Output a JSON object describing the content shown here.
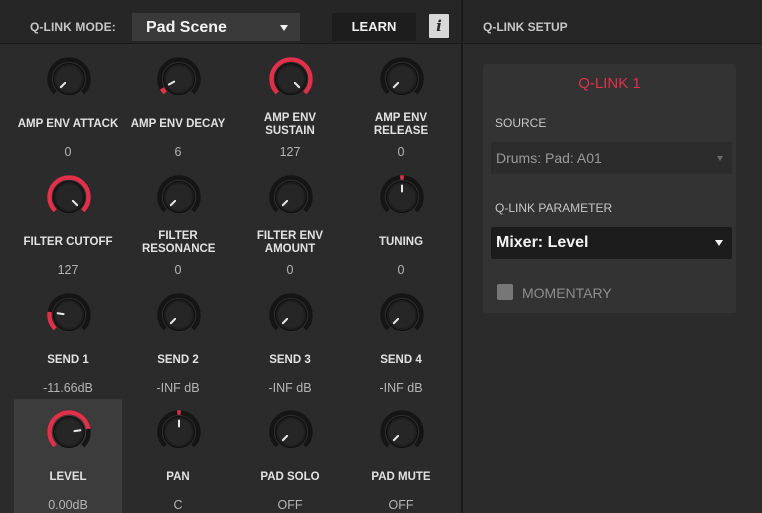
{
  "header": {
    "mode_label": "Q-LINK MODE:",
    "mode_value": "Pad Scene",
    "learn_label": "LEARN",
    "info_label": "i",
    "setup_title": "Q-LINK SETUP"
  },
  "colors": {
    "accent_red": "#e0304a",
    "background": "#2b2b2b",
    "panel": "#333333"
  },
  "knobs": [
    {
      "name": "amp-env-attack",
      "label": "AMP ENV ATTACK",
      "value": "0",
      "level": 0.0
    },
    {
      "name": "amp-env-decay",
      "label": "AMP ENV DECAY",
      "value": "6",
      "level": 0.06
    },
    {
      "name": "amp-env-sustain",
      "label": "AMP ENV SUSTAIN",
      "value": "127",
      "level": 1.0
    },
    {
      "name": "amp-env-release",
      "label": "AMP ENV RELEASE",
      "value": "0",
      "level": 0.0
    },
    {
      "name": "filter-cutoff",
      "label": "FILTER CUTOFF",
      "value": "127",
      "level": 1.0
    },
    {
      "name": "filter-resonance",
      "label": "FILTER RESONANCE",
      "value": "0",
      "level": 0.0
    },
    {
      "name": "filter-env-amount",
      "label": "FILTER ENV AMOUNT",
      "value": "0",
      "level": 0.0
    },
    {
      "name": "tuning",
      "label": "TUNING",
      "value": "0",
      "level": 0.5,
      "bipolar": true
    },
    {
      "name": "send-1",
      "label": "SEND 1",
      "value": "-11.66dB",
      "level": 0.2
    },
    {
      "name": "send-2",
      "label": "SEND 2",
      "value": "-INF dB",
      "level": 0.0
    },
    {
      "name": "send-3",
      "label": "SEND 3",
      "value": "-INF dB",
      "level": 0.0
    },
    {
      "name": "send-4",
      "label": "SEND 4",
      "value": "-INF dB",
      "level": 0.0
    },
    {
      "name": "level",
      "label": "LEVEL",
      "value": "0.00dB",
      "level": 0.8,
      "selected": true
    },
    {
      "name": "pan",
      "label": "PAN",
      "value": "C",
      "level": 0.5,
      "bipolar": true
    },
    {
      "name": "pad-solo",
      "label": "PAD SOLO",
      "value": "OFF",
      "level": 0.0
    },
    {
      "name": "pad-mute",
      "label": "PAD MUTE",
      "value": "OFF",
      "level": 0.0
    }
  ],
  "setup": {
    "qlink_title": "Q-LINK 1",
    "source_label": "SOURCE",
    "source_value": "Drums: Pad: A01",
    "param_label": "Q-LINK PARAMETER",
    "param_value": "Mixer: Level",
    "momentary_label": "MOMENTARY",
    "momentary_checked": false
  }
}
